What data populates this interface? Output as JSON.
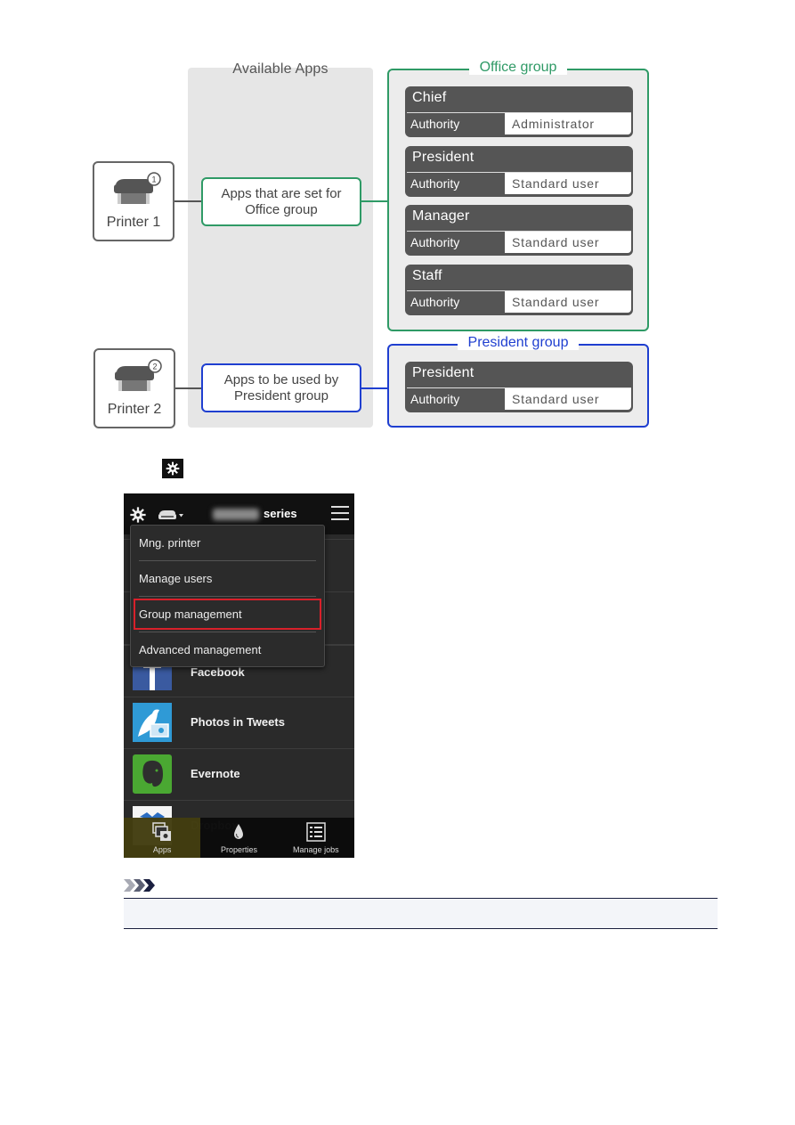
{
  "diagram": {
    "available_apps_title": "Available Apps",
    "printers": [
      {
        "label": "Printer 1",
        "badge": "1"
      },
      {
        "label": "Printer 2",
        "badge": "2"
      }
    ],
    "app_sets": [
      {
        "text": "Apps that are set for Office group",
        "color": "#2f9a66"
      },
      {
        "text": "Apps to be used by President group",
        "color": "#1f3fd0"
      }
    ],
    "groups": [
      {
        "title": "Office group",
        "color": "#2f9a66",
        "users": [
          {
            "name": "Chief",
            "authority_label": "Authority",
            "authority": "Administrator"
          },
          {
            "name": "President",
            "authority_label": "Authority",
            "authority": "Standard user"
          },
          {
            "name": "Manager",
            "authority_label": "Authority",
            "authority": "Standard user"
          },
          {
            "name": "Staff",
            "authority_label": "Authority",
            "authority": "Standard user"
          }
        ]
      },
      {
        "title": "President group",
        "color": "#1f3fd0",
        "users": [
          {
            "name": "President",
            "authority_label": "Authority",
            "authority": "Standard user"
          }
        ]
      }
    ]
  },
  "caption": {
    "icon": "gear-icon"
  },
  "phone": {
    "header": {
      "series_label": "series",
      "icons": [
        "gear-icon",
        "printer-select-icon",
        "hamburger-menu-icon"
      ]
    },
    "menu": {
      "items": [
        {
          "label": "Mng. printer"
        },
        {
          "label": "Manage users"
        },
        {
          "label": "Group management",
          "highlighted": true
        },
        {
          "label": "Advanced management"
        }
      ],
      "highlight_color": "#d8202a"
    },
    "apps": [
      {
        "name": "Facebook",
        "icon": "facebook-icon"
      },
      {
        "name": "Photos in Tweets",
        "icon": "photos-in-tweets-icon"
      },
      {
        "name": "Evernote",
        "icon": "evernote-icon"
      },
      {
        "name": "Dropbox",
        "icon": "dropbox-icon"
      }
    ],
    "tabs": [
      {
        "label": "Apps",
        "icon": "apps-icon",
        "active": true
      },
      {
        "label": "Properties",
        "icon": "ink-drop-icon",
        "active": false
      },
      {
        "label": "Manage jobs",
        "icon": "job-list-icon",
        "active": false
      }
    ]
  },
  "note": {
    "icon": "note-chevrons-icon",
    "text": ""
  }
}
